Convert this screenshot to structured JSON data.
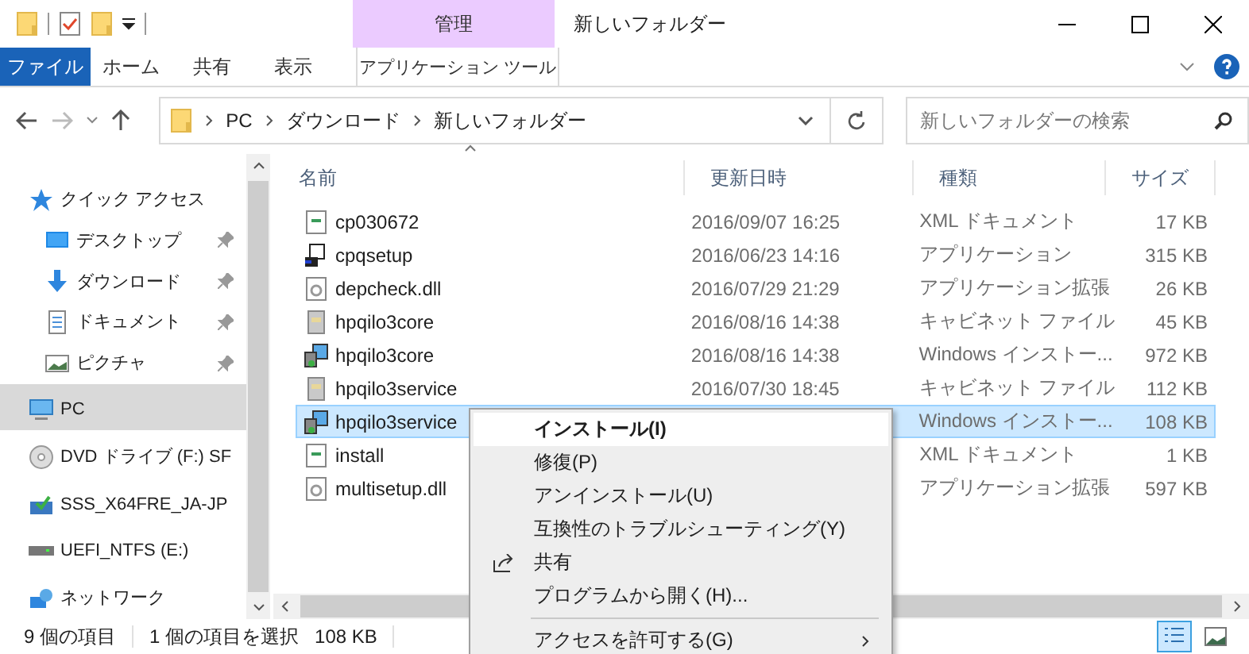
{
  "window": {
    "title": "新しいフォルダー",
    "context_tab": "管理"
  },
  "ribbon": {
    "tabs": [
      {
        "label": "ファイル",
        "kind": "file"
      },
      {
        "label": "ホーム",
        "kind": "tab"
      },
      {
        "label": "共有",
        "kind": "tab"
      },
      {
        "label": "表示",
        "kind": "tab"
      },
      {
        "label": "アプリケーション ツール",
        "kind": "context"
      }
    ]
  },
  "address": {
    "path": [
      "PC",
      "ダウンロード",
      "新しいフォルダー"
    ]
  },
  "search": {
    "placeholder": "新しいフォルダーの検索"
  },
  "sidebar": {
    "items": [
      {
        "label": "クイック アクセス",
        "kind": "star",
        "pinned": false,
        "selected": false
      },
      {
        "label": "デスクトップ",
        "kind": "desktop",
        "pinned": true,
        "selected": false
      },
      {
        "label": "ダウンロード",
        "kind": "download",
        "pinned": true,
        "selected": false
      },
      {
        "label": "ドキュメント",
        "kind": "document",
        "pinned": true,
        "selected": false
      },
      {
        "label": "ピクチャ",
        "kind": "picture",
        "pinned": true,
        "selected": false
      },
      {
        "label": "PC",
        "kind": "pc",
        "pinned": false,
        "selected": true
      },
      {
        "label": "DVD ドライブ (F:) SF",
        "kind": "dvd",
        "pinned": false,
        "selected": false
      },
      {
        "label": "SSS_X64FRE_JA-JP",
        "kind": "mounted",
        "pinned": false,
        "selected": false
      },
      {
        "label": "UEFI_NTFS (E:)",
        "kind": "drive",
        "pinned": false,
        "selected": false
      },
      {
        "label": "ネットワーク",
        "kind": "network",
        "pinned": false,
        "selected": false
      }
    ]
  },
  "columns": [
    {
      "label": "名前",
      "sorted": true
    },
    {
      "label": "更新日時",
      "sorted": false
    },
    {
      "label": "種類",
      "sorted": false
    },
    {
      "label": "サイズ",
      "sorted": false
    }
  ],
  "files": [
    {
      "name": "cp030672",
      "kind": "xml",
      "modified": "2016/09/07 16:25",
      "type": "XML ドキュメント",
      "size": "17 KB",
      "selected": false
    },
    {
      "name": "cpqsetup",
      "kind": "exe",
      "modified": "2016/06/23 14:16",
      "type": "アプリケーション",
      "size": "315 KB",
      "selected": false
    },
    {
      "name": "depcheck.dll",
      "kind": "dll",
      "modified": "2016/07/29 21:29",
      "type": "アプリケーション拡張",
      "size": "26 KB",
      "selected": false
    },
    {
      "name": "hpqilo3core",
      "kind": "cab",
      "modified": "2016/08/16 14:38",
      "type": "キャビネット ファイル",
      "size": "45 KB",
      "selected": false
    },
    {
      "name": "hpqilo3core",
      "kind": "msi",
      "modified": "2016/08/16 14:38",
      "type": "Windows インストー...",
      "size": "972 KB",
      "selected": false
    },
    {
      "name": "hpqilo3service",
      "kind": "cab",
      "modified": "2016/07/30 18:45",
      "type": "キャビネット ファイル",
      "size": "112 KB",
      "selected": false
    },
    {
      "name": "hpqilo3service",
      "kind": "msi",
      "type": "Windows インストー...",
      "size": "108 KB",
      "selected": true
    },
    {
      "name": "install",
      "kind": "xml",
      "type": "XML ドキュメント",
      "size": "1 KB",
      "selected": false
    },
    {
      "name": "multisetup.dll",
      "kind": "dll",
      "type": "アプリケーション拡張",
      "size": "597 KB",
      "selected": false
    }
  ],
  "context_menu": {
    "items": [
      {
        "label": "インストール(I)",
        "kind": "default",
        "selected": true
      },
      {
        "label": "修復(P)",
        "kind": "item",
        "selected": false
      },
      {
        "label": "アンインストール(U)",
        "kind": "item",
        "selected": false
      },
      {
        "label": "互換性のトラブルシューティング(Y)",
        "kind": "item",
        "selected": false
      },
      {
        "label": "共有",
        "kind": "share",
        "selected": false
      },
      {
        "label": "プログラムから開く(H)...",
        "kind": "item",
        "selected": false
      },
      {
        "label": "アクセスを許可する(G)",
        "kind": "submenu",
        "selected": false
      }
    ]
  },
  "status_bar": {
    "item_count": "9 個の項目",
    "selection": "1 個の項目を選択",
    "selection_size": "108 KB"
  },
  "view_buttons": [
    {
      "kind": "details",
      "selected": true
    },
    {
      "kind": "large-icons",
      "selected": false
    }
  ]
}
